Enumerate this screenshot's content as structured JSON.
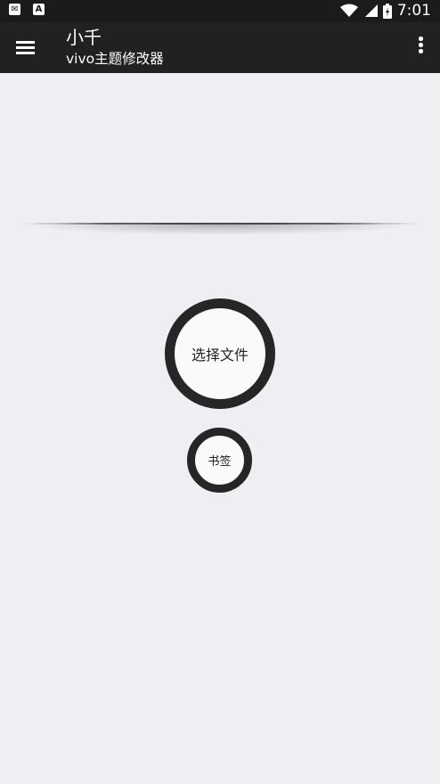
{
  "status_bar": {
    "time": "7:01",
    "left_icons": [
      "mail-icon",
      "a-icon"
    ],
    "right_icons": [
      "wifi-icon",
      "signal-icon",
      "battery-icon"
    ]
  },
  "app_bar": {
    "title": "小千",
    "subtitle": "vivo主题修改器",
    "menu_icon": "hamburger-menu-icon",
    "overflow_icon": "more-vert-icon"
  },
  "main": {
    "select_file_label": "选择文件",
    "bookmark_label": "书签"
  },
  "colors": {
    "status_bar_bg": "#1b1b1b",
    "app_bar_bg": "#212121",
    "content_bg": "#efeef3",
    "ring": "#262626"
  }
}
